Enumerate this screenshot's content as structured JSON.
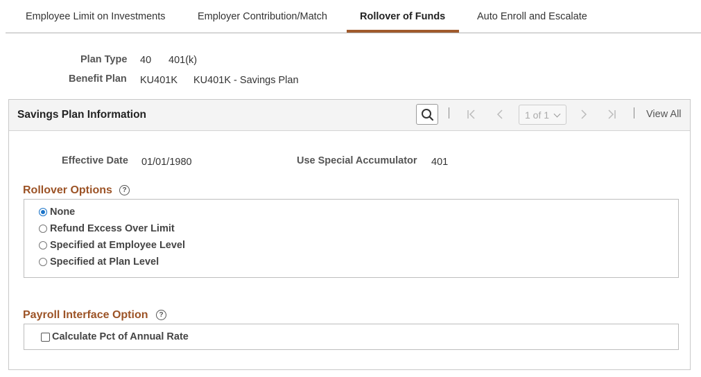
{
  "tabs": [
    {
      "label": "Employee Limit on Investments",
      "active": false
    },
    {
      "label": "Employer Contribution/Match",
      "active": false
    },
    {
      "label": "Rollover of Funds",
      "active": true
    },
    {
      "label": "Auto Enroll and Escalate",
      "active": false
    }
  ],
  "plan": {
    "plan_type_label": "Plan Type",
    "plan_type_code": "40",
    "plan_type_desc": "401(k)",
    "benefit_plan_label": "Benefit Plan",
    "benefit_plan_code": "KU401K",
    "benefit_plan_desc": "KU401K - Savings Plan"
  },
  "panel": {
    "title": "Savings Plan Information",
    "pager_text": "1 of 1",
    "view_all": "View All",
    "effective_date_label": "Effective Date",
    "effective_date": "01/01/1980",
    "accumulator_label": "Use Special Accumulator",
    "accumulator_value": "401"
  },
  "rollover": {
    "title": "Rollover Options",
    "options": [
      {
        "label": "None",
        "selected": true
      },
      {
        "label": "Refund Excess Over Limit",
        "selected": false
      },
      {
        "label": "Specified at Employee Level",
        "selected": false
      },
      {
        "label": "Specified at Plan Level",
        "selected": false
      }
    ]
  },
  "payroll": {
    "title": "Payroll Interface Option",
    "checkbox_label": "Calculate Pct of Annual Rate",
    "checked": false
  },
  "colors": {
    "accent": "#a05a2c",
    "section_title": "#9c5326",
    "radio_selected": "#1a73c8"
  }
}
